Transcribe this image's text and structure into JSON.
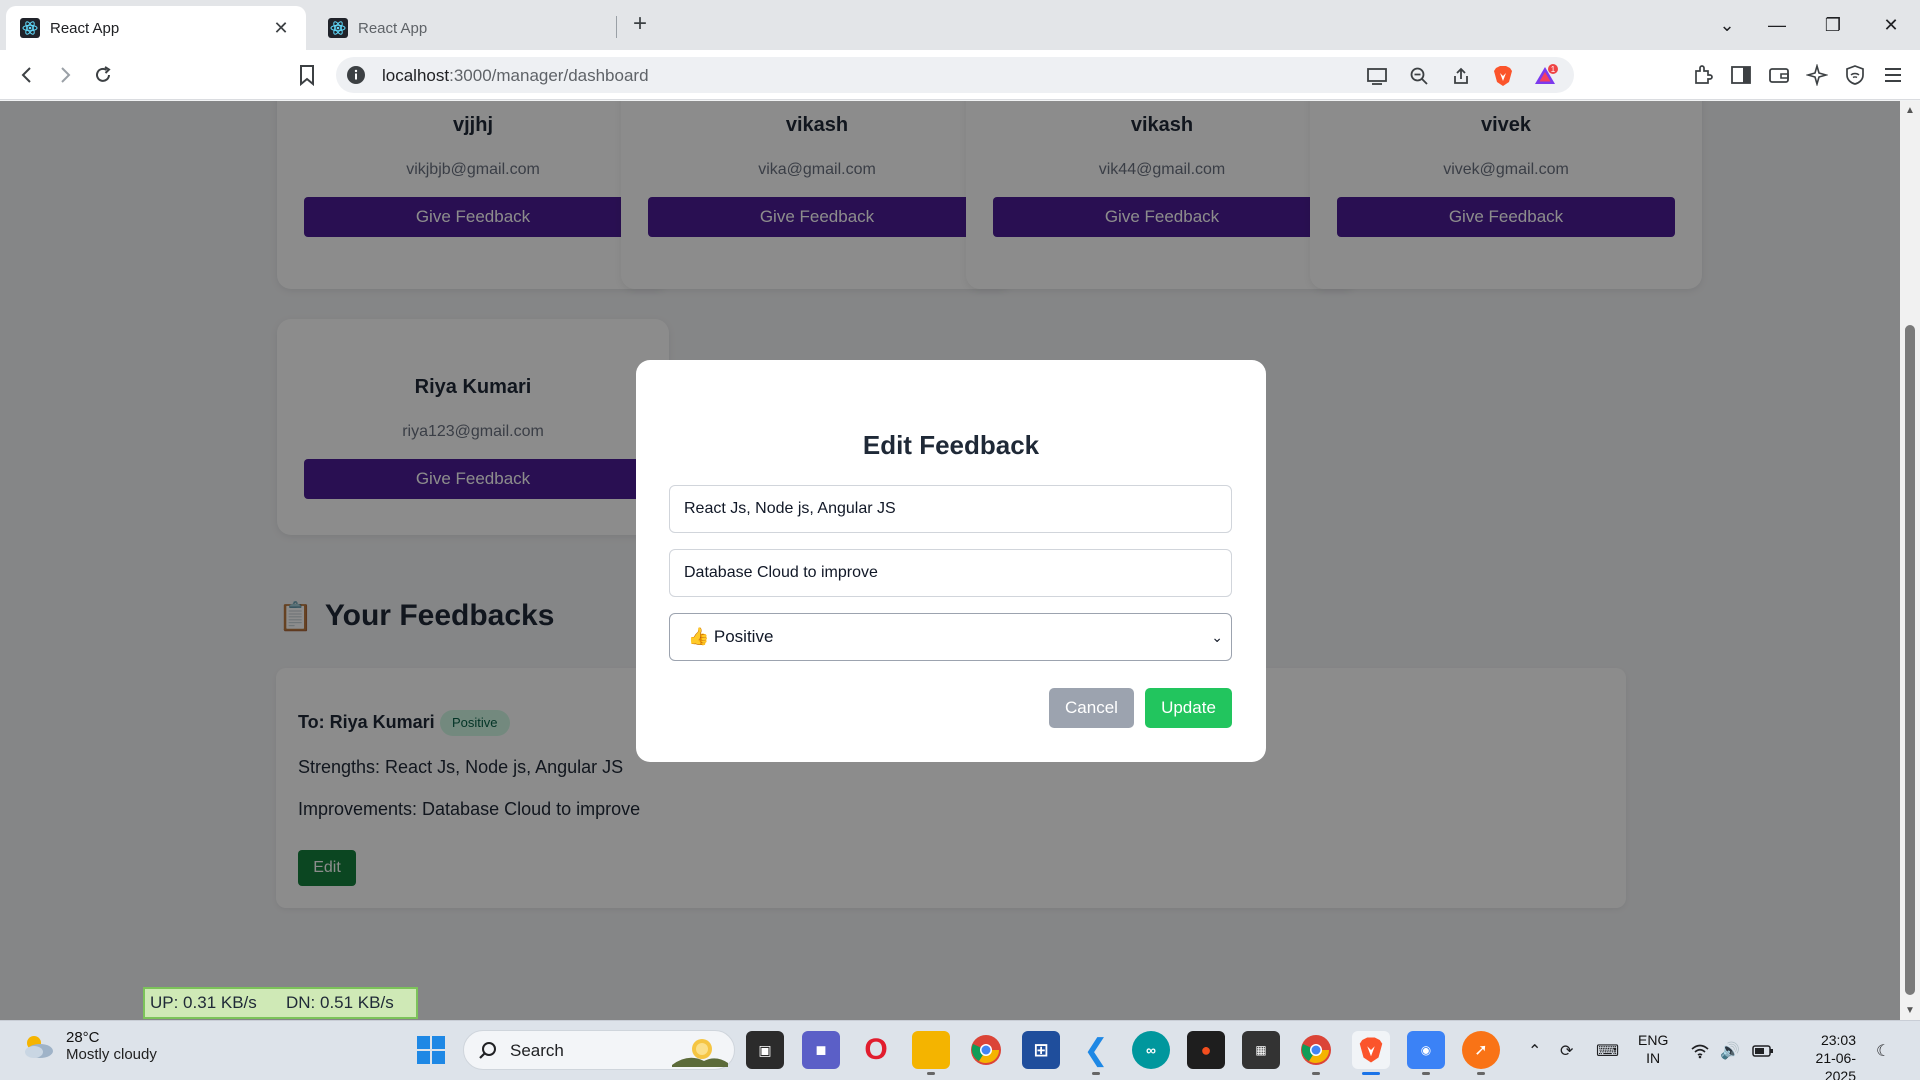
{
  "browser": {
    "tabs": [
      {
        "label": "React App",
        "active": true
      },
      {
        "label": "React App",
        "active": false
      }
    ],
    "url_host": "localhost",
    "url_path": ":3000/manager/dashboard",
    "brave_badge_count": "1"
  },
  "employees": [
    {
      "name": "vjjhj",
      "email": "vikjbjb@gmail.com",
      "button": "Give Feedback"
    },
    {
      "name": "vikash",
      "email": "vika@gmail.com",
      "button": "Give Feedback"
    },
    {
      "name": "vikash",
      "email": "vik44@gmail.com",
      "button": "Give Feedback"
    },
    {
      "name": "vivek",
      "email": "vivek@gmail.com",
      "button": "Give Feedback"
    },
    {
      "name": "Riya Kumari",
      "email": "riya123@gmail.com",
      "button": "Give Feedback"
    }
  ],
  "feedbacks_section": {
    "icon": "📋",
    "title": "Your Feedbacks",
    "items": [
      {
        "to": "To: Riya Kumari",
        "sentiment": "Positive",
        "strengths": "Strengths: React Js, Node js, Angular JS",
        "improvements": "Improvements: Database Cloud to improve",
        "edit_label": "Edit"
      }
    ]
  },
  "modal": {
    "title": "Edit Feedback",
    "strengths_value": "React Js, Node js, Angular JS",
    "improvements_value": "Database Cloud to improve",
    "sentiment_selected": "👍  Positive",
    "cancel_label": "Cancel",
    "update_label": "Update"
  },
  "netspeed": {
    "up": "UP: 0.31 KB/s",
    "down": "DN: 0.51 KB/s"
  },
  "taskbar": {
    "weather_temp": "28°C",
    "weather_desc": "Mostly cloudy",
    "search_label": "Search",
    "lang_top": "ENG",
    "lang_bottom": "IN",
    "time": "23:03",
    "date": "21-06-2025"
  },
  "colors": {
    "primary_button": "#4c1d95",
    "update_button": "#22c55e",
    "cancel_button": "#9ca3af",
    "edit_button": "#15803d"
  }
}
